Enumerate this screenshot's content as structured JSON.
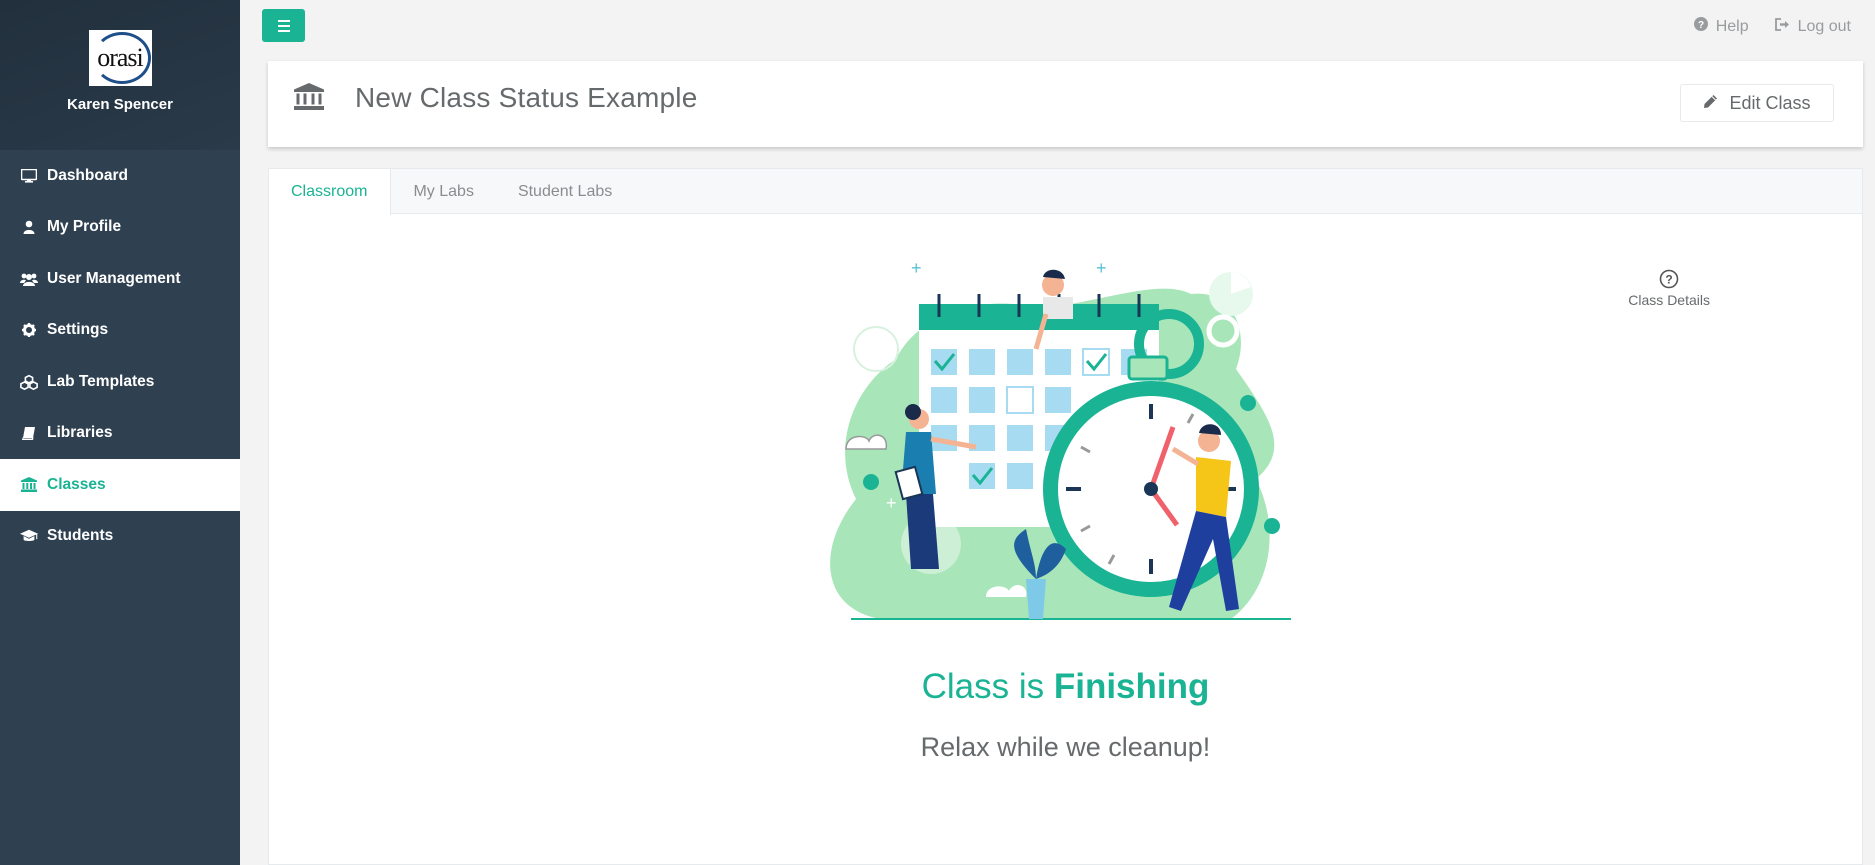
{
  "profile": {
    "logo_text": "orasi",
    "name": "Karen Spencer"
  },
  "sidebar": {
    "items": [
      {
        "label": "Dashboard",
        "icon": "desktop-icon"
      },
      {
        "label": "My Profile",
        "icon": "user-icon"
      },
      {
        "label": "User Management",
        "icon": "users-icon"
      },
      {
        "label": "Settings",
        "icon": "gear-icon"
      },
      {
        "label": "Lab Templates",
        "icon": "cubes-icon"
      },
      {
        "label": "Libraries",
        "icon": "book-icon"
      },
      {
        "label": "Classes",
        "icon": "bank-icon",
        "active": true
      },
      {
        "label": "Students",
        "icon": "graduation-cap-icon"
      }
    ]
  },
  "topbar": {
    "help_label": "Help",
    "logout_label": "Log out"
  },
  "header": {
    "title": "New Class Status Example",
    "edit_label": "Edit Class"
  },
  "tabs": [
    {
      "label": "Classroom",
      "active": true
    },
    {
      "label": "My Labs"
    },
    {
      "label": "Student Labs"
    }
  ],
  "content": {
    "class_details_label": "Class Details",
    "status_prefix": "Class is ",
    "status_value": "Finishing",
    "subtitle": "Relax while we cleanup!"
  },
  "colors": {
    "accent": "#1ab394",
    "sidebar": "#2f4050",
    "illustration_green": "#a8e6b9"
  }
}
